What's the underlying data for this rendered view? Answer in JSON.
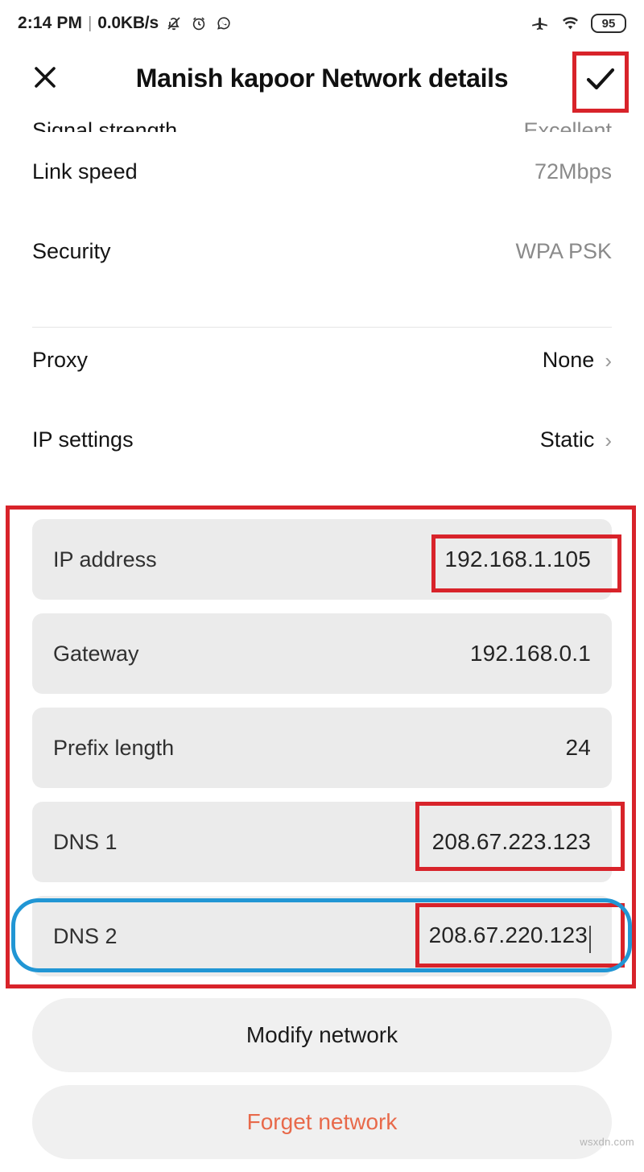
{
  "status_bar": {
    "time": "2:14 PM",
    "separator": "|",
    "network_speed": "0.0KB/s",
    "icons_left": [
      "bell-muted-icon",
      "alarm-clock-icon",
      "whatsapp-icon"
    ],
    "icons_right": [
      "airplane-mode-icon",
      "wifi-icon"
    ],
    "battery_level": "95"
  },
  "app_bar": {
    "close_label": "close-icon",
    "title": "Manish kapoor Network details",
    "confirm_label": "check-icon"
  },
  "details": [
    {
      "label": "Signal strength",
      "value": "Excellent",
      "clipped": true,
      "chevron": false
    },
    {
      "label": "Link speed",
      "value": "72Mbps",
      "clipped": false,
      "chevron": false
    },
    {
      "label": "Security",
      "value": "WPA PSK",
      "clipped": false,
      "chevron": false
    }
  ],
  "settings": [
    {
      "label": "Proxy",
      "value": "None",
      "chevron": "›"
    },
    {
      "label": "IP settings",
      "value": "Static",
      "chevron": "›"
    }
  ],
  "ip_fields": [
    {
      "label": "IP address",
      "value": "192.168.1.105"
    },
    {
      "label": "Gateway",
      "value": "192.168.0.1"
    },
    {
      "label": "Prefix length",
      "value": "24"
    },
    {
      "label": "DNS 1",
      "value": "208.67.223.123"
    },
    {
      "label": "DNS 2",
      "value": "208.67.220.123"
    }
  ],
  "actions": {
    "modify": "Modify network",
    "forget": "Forget network"
  },
  "watermark": "wsxdn.com",
  "colors": {
    "annotation_red": "#d8232a",
    "annotation_blue": "#2196d4",
    "field_background": "#ebebeb",
    "button_background": "#f0f0f0",
    "forget_text": "#e8694a"
  }
}
